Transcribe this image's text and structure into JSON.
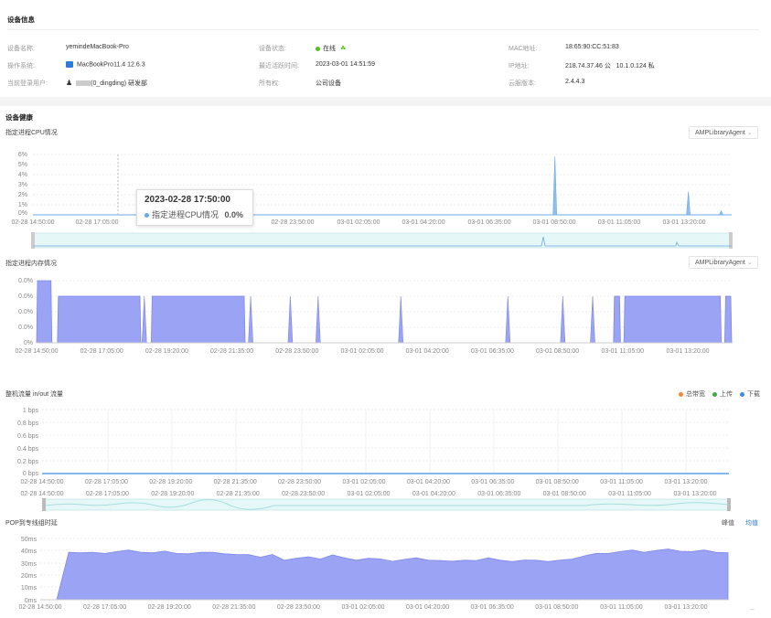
{
  "device_info": {
    "title": "设备信息",
    "fields": [
      {
        "label": "设备名称:",
        "value": "yemindeMacBook-Pro"
      },
      {
        "label": "操作系统:",
        "value": "MacBookPro11.4 12.6.3"
      },
      {
        "label": "当前登录用户:",
        "value": "(0_dingding) 研发部"
      },
      {
        "label": "设备状态:",
        "value": "在线"
      },
      {
        "label": "最近活跃时间:",
        "value": "2023-03-01 14:51:59"
      },
      {
        "label": "所有权:",
        "value": "公司设备"
      },
      {
        "label": "MAC地址:",
        "value": "18:65:90:CC:51:83"
      },
      {
        "label": "IP地址:",
        "value": "218.74.37.46 公   10.1.0.124 私"
      },
      {
        "label": "云服版本:",
        "value": "2.4.4.3"
      }
    ],
    "status_color": "#52c41a"
  },
  "health": {
    "title": "设备健康"
  },
  "cpu_chart": {
    "title": "指定进程CPU情况",
    "select_value": "AMPLibraryAgent",
    "tooltip": {
      "time": "2023-02-28 17:50:00",
      "series": "指定进程CPU情况",
      "value": "0.0%"
    },
    "color": "#6aa9e9"
  },
  "mem_chart": {
    "title": "指定进程内存情况",
    "select_value": "AMPLibraryAgent",
    "color": "#8f97f0"
  },
  "flow_chart": {
    "title": "整机流量 in/out 流量",
    "legend": [
      {
        "label": "总带宽",
        "color": "#f08a3c"
      },
      {
        "label": "上传",
        "color": "#3cae3c"
      },
      {
        "label": "下载",
        "color": "#3a8ee6"
      }
    ]
  },
  "pop_chart": {
    "title": "POP到专线组时延",
    "toggle_peak": "峰值",
    "toggle_avg": "均值",
    "color": "#8f97f0"
  },
  "chart_data": [
    {
      "type": "area",
      "title": "指定进程CPU情况",
      "x": [
        "02-28 14:50:00",
        "02-28 17:05:00",
        "02-28 19:20:00",
        "02-28 21:35:00",
        "02-28 23:50:00",
        "03-01 02:05:00",
        "03-01 04:20:00",
        "03-01 06:35:00",
        "03-01 08:50:00",
        "03-01 11:05:00",
        "03-01 13:20:00"
      ],
      "x_tick_labels": [
        "02-28 14:50:00",
        "02-28 17:05:00",
        "02-28 23:50:00",
        "03-01 02:05:00",
        "03-01 04:20:00",
        "03-01 06:35:00",
        "03-01 08:50:00",
        "03-01 11:05:00",
        "03-01 13:20:00"
      ],
      "y_ticks": [
        "0%",
        "1%",
        "2%",
        "3%",
        "4%",
        "5%",
        "6%"
      ],
      "ylim": [
        0,
        6
      ],
      "spikes": [
        {
          "x": 0.747,
          "value": 5.8
        },
        {
          "x": 0.938,
          "value": 2.3
        },
        {
          "x": 0.985,
          "value": 0.4
        }
      ]
    },
    {
      "type": "area",
      "title": "指定进程内存情况",
      "x": [
        "02-28 14:50:00",
        "02-28 17:05:00",
        "02-28 19:20:00",
        "02-28 21:35:00",
        "02-28 23:50:00",
        "03-01 02:05:00",
        "03-01 04:20:00",
        "03-01 06:35:00",
        "03-01 08:50:00",
        "03-01 11:05:00",
        "03-01 13:20:00"
      ],
      "y_ticks": [
        "0%",
        "0.0%",
        "0.0%",
        "0.0%",
        "0.0%"
      ],
      "blocks": [
        {
          "start": 0.0,
          "end": 0.022,
          "level": 1.0
        },
        {
          "start": 0.03,
          "end": 0.15,
          "level": 0.75
        },
        {
          "start": 0.165,
          "end": 0.3,
          "level": 0.75
        },
        {
          "start": 0.83,
          "end": 0.84,
          "level": 0.75
        },
        {
          "start": 0.845,
          "end": 0.985,
          "level": 0.75
        },
        {
          "start": 0.99,
          "end": 1.0,
          "level": 0.75
        }
      ],
      "spikes": [
        0.155,
        0.308,
        0.365,
        0.405,
        0.524,
        0.678,
        0.757,
        0.8
      ]
    },
    {
      "type": "line",
      "title": "整机流量 in/out 流量",
      "x": [
        "02-28 14:50:00",
        "02-28 17:05:00",
        "02-28 19:20:00",
        "02-28 21:35:00",
        "02-28 23:50:00",
        "03-01 02:05:00",
        "03-01 04:20:00",
        "03-01 06:35:00",
        "03-01 08:50:00",
        "03-01 11:05:00",
        "03-01 13:20:00"
      ],
      "y_ticks": [
        "0 bps",
        "0.2 bps",
        "0.4 bps",
        "0.6 bps",
        "0.8 bps",
        "1 bps"
      ],
      "ylim": [
        0,
        1
      ],
      "series": [
        {
          "name": "总带宽",
          "value": 0
        },
        {
          "name": "上传",
          "value": 0
        },
        {
          "name": "下载",
          "value": 0
        }
      ]
    },
    {
      "type": "area",
      "title": "POP到专线组时延",
      "x": [
        "02-28 14:50:00",
        "02-28 17:05:00",
        "02-28 19:20:00",
        "02-28 21:35:00",
        "02-28 23:50:00",
        "03-01 02:05:00",
        "03-01 04:20:00",
        "03-01 06:35:00",
        "03-01 08:50:00",
        "03-01 11:05:00",
        "03-01 13:20:00"
      ],
      "y_ticks": [
        "0ms",
        "10ms",
        "20ms",
        "30ms",
        "40ms",
        "50ms"
      ],
      "ylim": [
        0,
        55
      ],
      "values": [
        0,
        43,
        42,
        42,
        42,
        43,
        44,
        43,
        42,
        43,
        42,
        41,
        42,
        43,
        41,
        40,
        41,
        38,
        40,
        36,
        37,
        38,
        37,
        40,
        37,
        36,
        37,
        36,
        35,
        36,
        37,
        36,
        35,
        34,
        36,
        35,
        37,
        36,
        34,
        35,
        36,
        34,
        35,
        37,
        39,
        41,
        42,
        43,
        44,
        43,
        44,
        45,
        44,
        43,
        44,
        43,
        42
      ]
    }
  ]
}
